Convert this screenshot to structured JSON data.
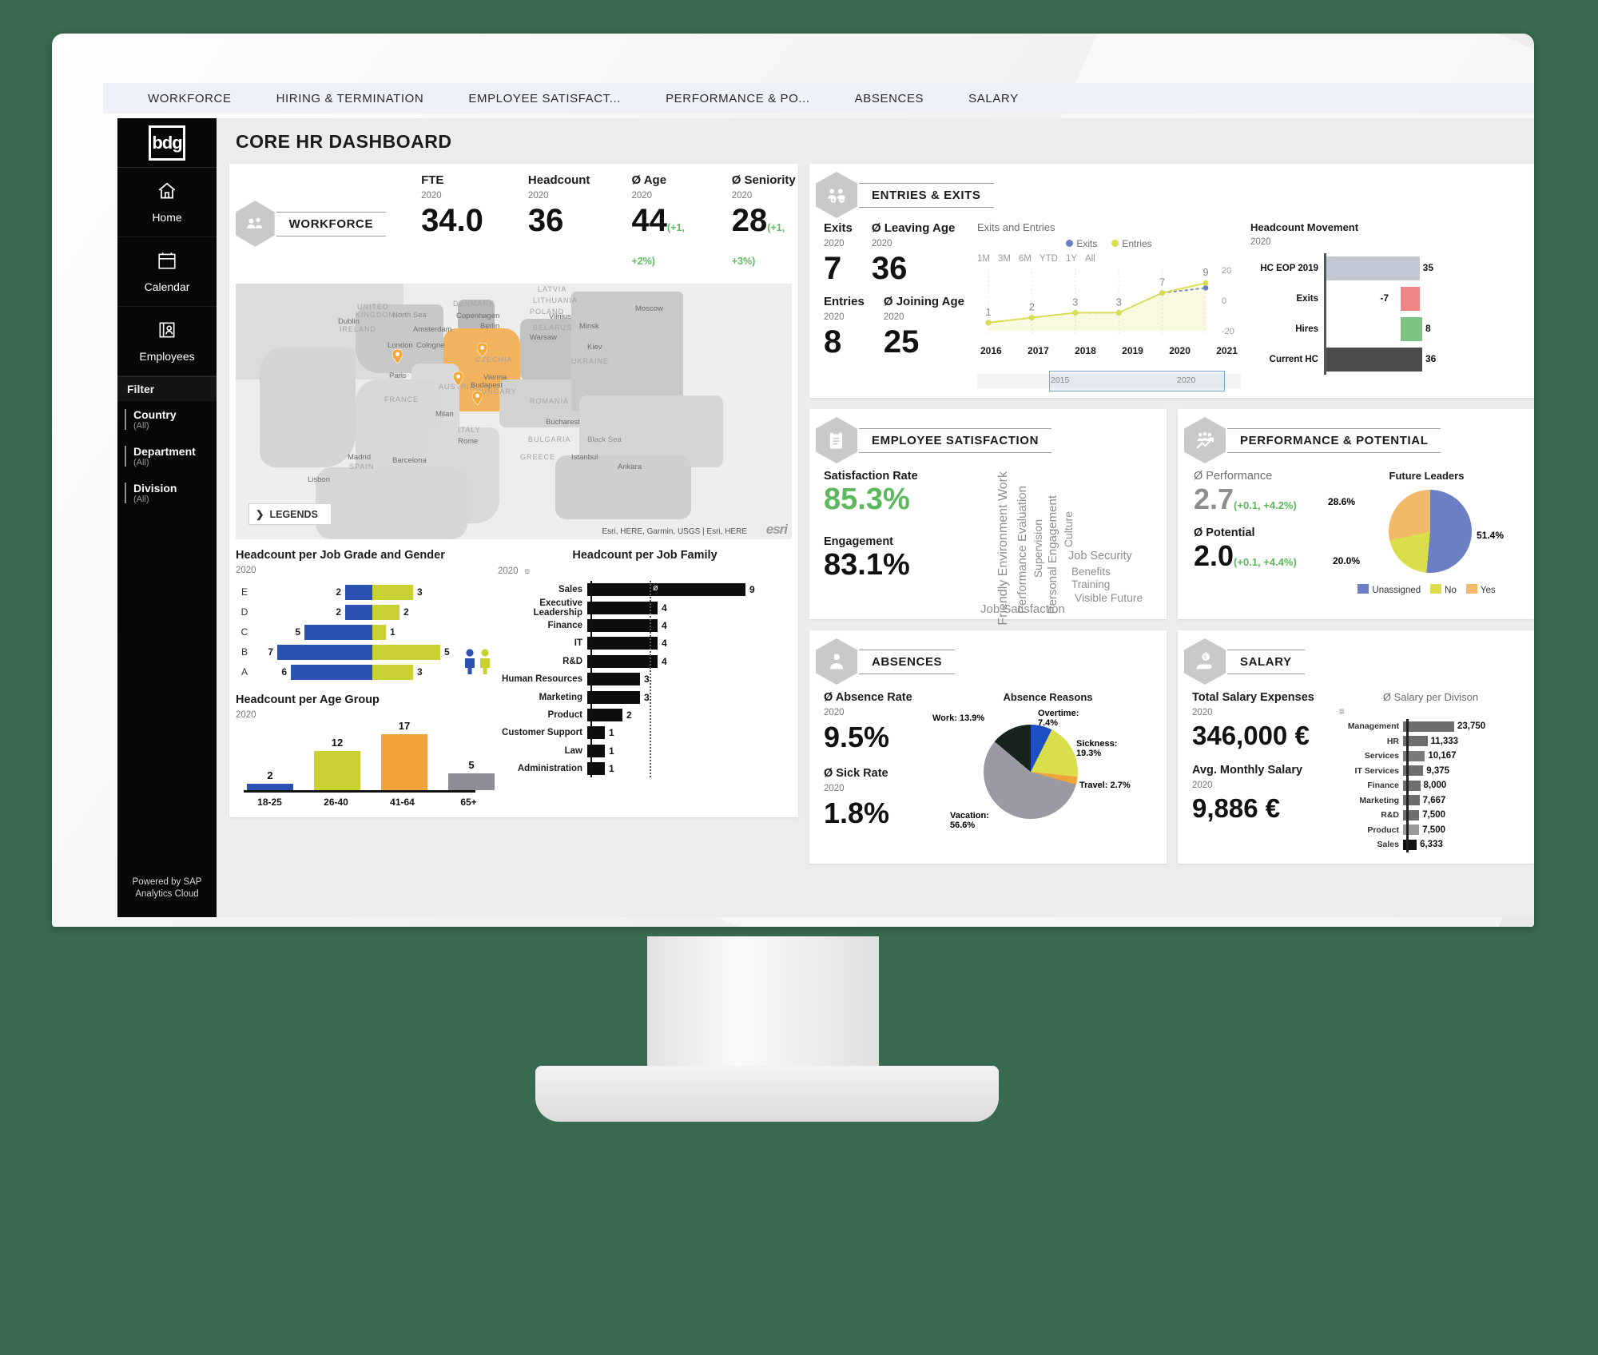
{
  "topnav": {
    "tabs": [
      "WORKFORCE",
      "HIRING & TERMINATION",
      "EMPLOYEE SATISFACT...",
      "PERFORMANCE & PO...",
      "ABSENCES",
      "SALARY"
    ]
  },
  "sidebar": {
    "logo": "bdg",
    "items": [
      {
        "label": "Home",
        "icon": "home-icon"
      },
      {
        "label": "Calendar",
        "icon": "calendar-icon"
      },
      {
        "label": "Employees",
        "icon": "employees-icon"
      }
    ],
    "filter_title": "Filter",
    "filters": [
      {
        "name": "Country",
        "value": "(All)"
      },
      {
        "name": "Department",
        "value": "(All)"
      },
      {
        "name": "Division",
        "value": "(All)"
      }
    ],
    "powered_line1": "Powered by SAP",
    "powered_line2": "Analytics Cloud"
  },
  "page_title": "CORE HR DASHBOARD",
  "workforce": {
    "panel_label": "WORKFORCE",
    "kpis": [
      {
        "title": "FTE",
        "year": "2020",
        "value": "34.0",
        "delta": ""
      },
      {
        "title": "Headcount",
        "year": "2020",
        "value": "36",
        "delta": ""
      },
      {
        "title": "Ø Age",
        "year": "2020",
        "value": "44",
        "delta": "(+1, +2%)"
      },
      {
        "title": "Ø Seniority",
        "year": "2020",
        "value": "28",
        "delta": "(+1, +3%)"
      }
    ],
    "map": {
      "legends_label": "LEGENDS",
      "attribution": "Esri, HERE, Garmin, USGS | Esri, HERE",
      "brand": "esri",
      "labels": [
        "North Sea",
        "DENMARK",
        "Copenhagen",
        "LITHUANIA",
        "Vilnius",
        "Moscow",
        "BELARUS",
        "Minsk",
        "UNITED KINGDOM",
        "IRELAND",
        "Dublin",
        "Amsterdam",
        "Berlin",
        "POLAND",
        "Warsaw",
        "Kiev",
        "UKRAINE",
        "London",
        "Cologne",
        "CZECHIA",
        "Paris",
        "Vienna",
        "FRANCE",
        "AUSTRIA",
        "HUNGARY",
        "Budapest",
        "ROMANIA",
        "Milan",
        "Bucharest",
        "BULGARIA",
        "Black Sea",
        "ITALY",
        "Rome",
        "Madrid",
        "SPAIN",
        "Barcelona",
        "Istanbul",
        "GREECE",
        "Ankara",
        "Lisbon",
        "LATVIA"
      ]
    }
  },
  "entries_exits": {
    "panel_label": "ENTRIES & EXITS",
    "kpis": [
      {
        "title": "Exits",
        "year": "2020",
        "value": "7"
      },
      {
        "title": "Ø Leaving Age",
        "year": "2020",
        "value": "36"
      },
      {
        "title": "Entries",
        "year": "2020",
        "value": "8"
      },
      {
        "title": "Ø Joining Age",
        "year": "2020",
        "value": "25"
      }
    ],
    "range_options": [
      "1M",
      "3M",
      "6M",
      "YTD",
      "1Y",
      "All"
    ],
    "slider": {
      "from": "2015",
      "to": "2020"
    }
  },
  "headcount_movement": {
    "title": "Headcount Movement",
    "year": "2020"
  },
  "employee_satisfaction": {
    "panel_label": "EMPLOYEE SATISFACTION",
    "satisfaction_label": "Satisfaction Rate",
    "satisfaction_value": "85.3%",
    "satisfaction_color": "#5cb85c",
    "engagement_label": "Engagement",
    "engagement_value": "83.1%",
    "cloud_words": [
      "Friendly Environment Work",
      "Performance Evaluation",
      "Supervision",
      "Personal Engagement",
      "Culture",
      "Job Security",
      "Benefits",
      "Training",
      "Visible Future",
      "Job Satisfaction"
    ]
  },
  "performance": {
    "panel_label": "PERFORMANCE & POTENTIAL",
    "perf_label": "Ø Performance",
    "perf_value": "2.7",
    "perf_delta": "(+0.1, +4.2%)",
    "pot_label": "Ø Potential",
    "pot_value": "2.0",
    "pot_delta": "(+0.1, +4.4%)"
  },
  "absences": {
    "panel_label": "ABSENCES",
    "absence_label": "Ø Absence Rate",
    "absence_year": "2020",
    "absence_value": "9.5%",
    "sick_label": "Ø Sick Rate",
    "sick_year": "2020",
    "sick_value": "1.8%"
  },
  "salary": {
    "panel_label": "SALARY",
    "total_label": "Total Salary Expenses",
    "total_year": "2020",
    "total_value": "346,000 €",
    "avg_label": "Avg. Monthly Salary",
    "avg_year": "2020",
    "avg_value": "9,886 €"
  },
  "chart_data": [
    {
      "type": "line",
      "title": "Exits and Entries",
      "x": [
        "2016",
        "2017",
        "2018",
        "2019",
        "2020",
        "2021"
      ],
      "point_labels": [
        "1",
        "2",
        "3",
        "3",
        "7",
        "9"
      ],
      "series": [
        {
          "name": "Exits",
          "values": [
            1,
            2,
            3,
            3,
            7,
            8
          ],
          "color": "#6a7fc4"
        },
        {
          "name": "Entries",
          "values": [
            1,
            2,
            3,
            3,
            7,
            9
          ],
          "color": "#d9de4a"
        }
      ],
      "ylim": [
        -20,
        20
      ],
      "ytick_labels": [
        "20",
        "0",
        "-20"
      ],
      "legend": "top"
    },
    {
      "type": "bar",
      "title": "Headcount Movement",
      "orientation": "horizontal-waterfall",
      "categories": [
        "HC EOP 2019",
        "Exits",
        "Hires",
        "Current HC"
      ],
      "values": [
        35,
        -7,
        8,
        36
      ],
      "value_labels": [
        "35",
        "-7",
        "8",
        "36"
      ],
      "colors": [
        "#c3c9d4",
        "#ef8585",
        "#7cc47f",
        "#4c4c4c"
      ]
    },
    {
      "type": "bar",
      "title": "Headcount per Job Grade and Gender",
      "year": "2020",
      "orientation": "diverging-horizontal",
      "categories": [
        "E",
        "D",
        "C",
        "B",
        "A"
      ],
      "series": [
        {
          "name": "Male",
          "values": [
            2,
            2,
            5,
            7,
            6
          ],
          "color": "#2b52b0"
        },
        {
          "name": "Female",
          "values": [
            3,
            2,
            1,
            5,
            3
          ],
          "color": "#c9d232"
        }
      ]
    },
    {
      "type": "bar",
      "title": "Headcount per Job Family",
      "year": "2020",
      "orientation": "horizontal",
      "categories": [
        "Sales",
        "Executive Leadership",
        "Finance",
        "IT",
        "R&D",
        "Human Resources",
        "Marketing",
        "Product",
        "Customer Support",
        "Law",
        "Administration"
      ],
      "values": [
        9,
        4,
        4,
        4,
        4,
        3,
        3,
        2,
        1,
        1,
        1
      ],
      "average_marker_label": "ø",
      "average_value": 3.3
    },
    {
      "type": "bar",
      "title": "Headcount per Age Group",
      "year": "2020",
      "categories": [
        "18-25",
        "26-40",
        "41-64",
        "65+"
      ],
      "values": [
        2,
        12,
        17,
        5
      ],
      "colors": [
        "#2b52b0",
        "#c9d232",
        "#f0a33c",
        "#8e8e99"
      ]
    },
    {
      "type": "pie",
      "title": "Future Leaders",
      "labels": [
        "Unassigned",
        "No",
        "Yes"
      ],
      "values": [
        51.4,
        20.0,
        28.6
      ],
      "value_labels": [
        "51.4%",
        "20.0%",
        "28.6%"
      ],
      "colors": [
        "#6a7fc4",
        "#d9de4a",
        "#f3b96b"
      ],
      "legend": "bottom"
    },
    {
      "type": "pie",
      "title": "Absence Reasons",
      "labels": [
        "Vacation",
        "Sickness",
        "Work",
        "Overtime",
        "Travel"
      ],
      "values": [
        56.6,
        19.3,
        13.9,
        7.4,
        2.7
      ],
      "value_labels": [
        "Vacation: 56.6%",
        "Sickness: 19.3%",
        "Work: 13.9%",
        "Overtime: 7.4%",
        "Travel: 2.7%"
      ],
      "colors": [
        "#9a9aa2",
        "#d9de4a",
        "#15231c",
        "#1f4fc4",
        "#f0a33c"
      ]
    },
    {
      "type": "bar",
      "title": "Ø Salary per Divison",
      "orientation": "horizontal",
      "categories": [
        "Management",
        "HR",
        "Services",
        "IT Services",
        "Finance",
        "Marketing",
        "R&D",
        "Product",
        "Sales"
      ],
      "values": [
        23750,
        11333,
        10167,
        9375,
        8000,
        7667,
        7500,
        7500,
        6333
      ],
      "value_labels": [
        "23,750",
        "11,333",
        "10,167",
        "9,375",
        "8,000",
        "7,667",
        "7,500",
        "7,500",
        "6,333"
      ],
      "colors": [
        "#6e6e6e",
        "#6e6e6e",
        "#7a7a7a",
        "#6e6e6e",
        "#6e6e6e",
        "#6e6e6e",
        "#6e6e6e",
        "#9a9a9a",
        "#111111"
      ]
    }
  ]
}
